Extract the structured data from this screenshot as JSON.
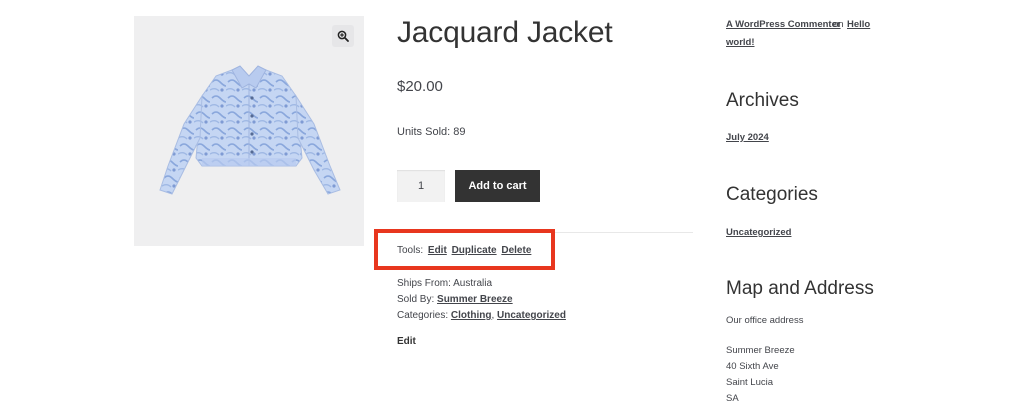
{
  "product": {
    "title": "Jacquard Jacket",
    "price": "$20.00",
    "units_sold": "Units Sold: 89",
    "quantity": "1",
    "add_to_cart": "Add to cart"
  },
  "tools": {
    "label": "Tools:",
    "edit": "Edit",
    "duplicate": "Duplicate",
    "delete": "Delete"
  },
  "meta": {
    "ships_from": "Ships From: Australia",
    "sold_by_label": "Sold By:",
    "sold_by": "Summer Breeze",
    "categories_label": "Categories:",
    "categories": [
      "Clothing",
      "Uncategorized"
    ],
    "edit": "Edit"
  },
  "sidebar": {
    "comment": {
      "author": "A WordPress Commenter",
      "on": "on",
      "post_part1": "Hello",
      "post_part2": "world!"
    },
    "archives_title": "Archives",
    "archives": [
      "July 2024"
    ],
    "categories_title": "Categories",
    "categories": [
      "Uncategorized"
    ],
    "map_title": "Map and Address",
    "office_label": "Our office address",
    "address": [
      "Summer Breeze",
      "40 Sixth Ave",
      "Saint Lucia",
      "SA"
    ]
  },
  "colors": {
    "highlight": "#e8361e",
    "button": "#333333"
  },
  "icons": {
    "zoom": "magnifier-plus-icon"
  }
}
